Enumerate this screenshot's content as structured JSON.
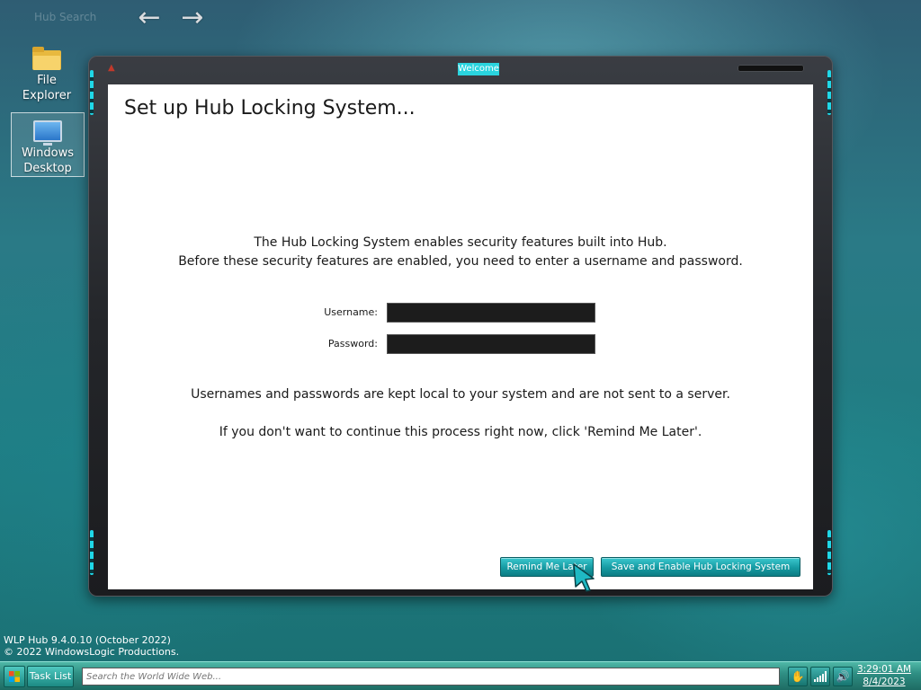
{
  "desktop": {
    "hub_label": "Hub Search",
    "icons": [
      {
        "label_line1": "File",
        "label_line2": "Explorer"
      },
      {
        "label_line1": "Windows",
        "label_line2": "Desktop"
      }
    ],
    "build_info": {
      "line1": "WLP Hub 9.4.0.10 (October 2022)",
      "line2": "© 2022 WindowsLogic Productions."
    }
  },
  "window": {
    "title": "Welcome",
    "heading": "Set up Hub Locking System...",
    "intro_line1": "The Hub Locking System enables security features built into Hub.",
    "intro_line2": "Before these security features are enabled, you need to enter a username and password.",
    "username_label": "Username:",
    "username_value": "",
    "password_label": "Password:",
    "password_value": "",
    "note_local": "Usernames and passwords are kept local to your system and are not sent to a server.",
    "note_remind": "If you don't want to continue this process right now, click 'Remind Me Later'.",
    "remind_button": "Remind Me Later",
    "save_button": "Save and Enable Hub Locking System"
  },
  "taskbar": {
    "task_list_label": "Task List",
    "search_placeholder": "Search the World Wide Web...",
    "clock_time": "3:29:01 AM",
    "clock_date": "8/4/2023"
  },
  "icons": {
    "back": "arrow-left-icon",
    "forward": "arrow-right-icon",
    "start": "windows-flag-icon",
    "notification": "hand-icon",
    "signal": "signal-bars-icon",
    "volume": "speaker-icon"
  },
  "colors": {
    "accent": "#1fa8b0",
    "title_highlight": "#2ad4de",
    "window_frame": "#24262a",
    "input_background": "#1c1c1c"
  }
}
